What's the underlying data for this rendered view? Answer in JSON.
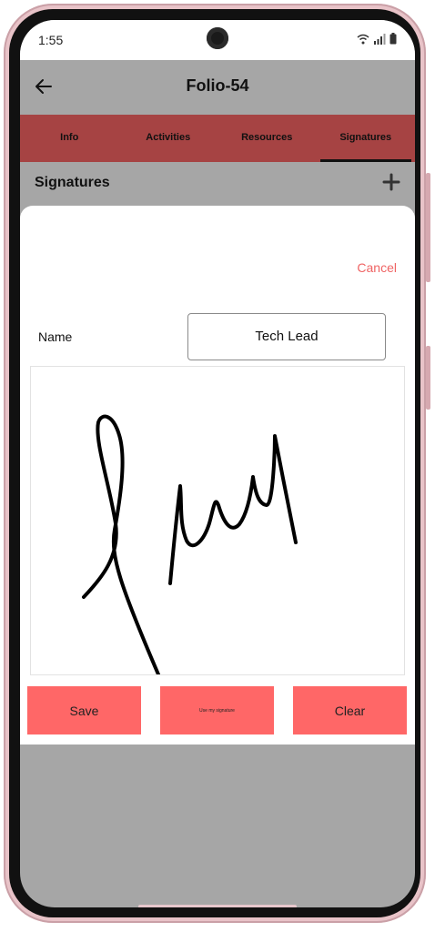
{
  "status_bar": {
    "time": "1:55"
  },
  "header": {
    "title": "Folio-54"
  },
  "tabs": [
    {
      "label": "Info"
    },
    {
      "label": "Activities"
    },
    {
      "label": "Resources"
    },
    {
      "label": "Signatures",
      "active": true
    }
  ],
  "section": {
    "title": "Signatures"
  },
  "sheet": {
    "cancel_label": "Cancel",
    "name_label": "Name",
    "name_value": "Tech Lead",
    "buttons": {
      "save": "Save",
      "use_my_signature": "Use my signature",
      "clear": "Clear"
    }
  },
  "colors": {
    "accent": "#ff6767",
    "tab_bar": "#a64343",
    "cancel": "#ef6464",
    "background": "#a6a6a6"
  },
  "icons": [
    "back-arrow-icon",
    "plus-icon",
    "wifi-icon",
    "signal-icon",
    "battery-icon",
    "camera-icon"
  ]
}
